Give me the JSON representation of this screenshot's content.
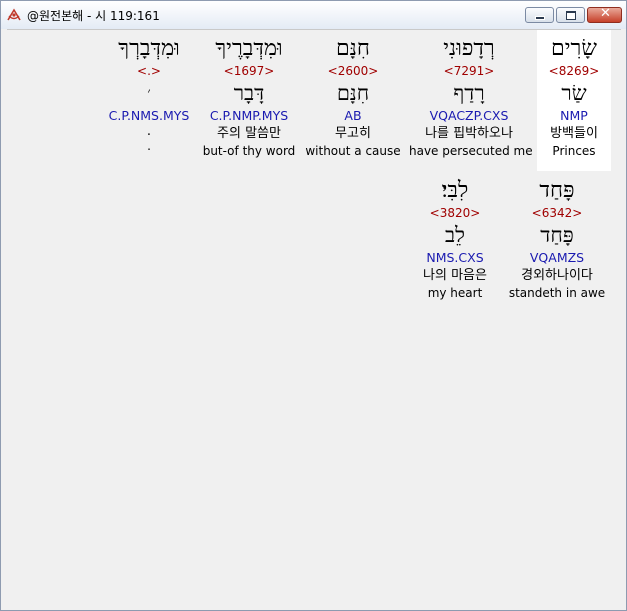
{
  "window": {
    "title": "@원전본해 - 시 119:161"
  },
  "words": [
    {
      "hebrew": "שָׂרִים",
      "strong": "<8269>",
      "lemma": "שַׂר",
      "morph": "NMP",
      "korean": "방백들이",
      "english": "Princes"
    },
    {
      "hebrew": "רְדָפוּנִי",
      "strong": "<7291>",
      "lemma": "רָדַף",
      "morph": "VQACZP.CXS",
      "korean": "나를 핍박하오나",
      "english": "have persecuted me"
    },
    {
      "hebrew": "חִנָּם",
      "strong": "<2600>",
      "lemma": "חִנָּם",
      "morph": "AB",
      "korean": "무고히",
      "english": "without a cause"
    },
    {
      "hebrew": "וּמִדְּבָרֶיךָ",
      "strong": "<1697>",
      "lemma": "דָּבָר",
      "morph": "C.P.NMP.MYS",
      "korean": "주의 말씀만",
      "english": "but-of thy word"
    },
    {
      "hebrew": "וּמִדְּבָרְךָ",
      "strong": "<.>",
      "lemma": "׳",
      "morph": "C.P.NMS.MYS",
      "korean": ".",
      "english": "."
    },
    {
      "hebrew": "פָּחַד",
      "strong": "<6342>",
      "lemma": "פָּחַד",
      "morph": "VQAMZS",
      "korean": "경외하나이다",
      "english": "standeth in awe"
    },
    {
      "hebrew": "לִבִּי׃",
      "strong": "<3820>",
      "lemma": "לֵב",
      "morph": "NMS.CXS",
      "korean": "나의 마음은",
      "english": "my heart"
    }
  ]
}
